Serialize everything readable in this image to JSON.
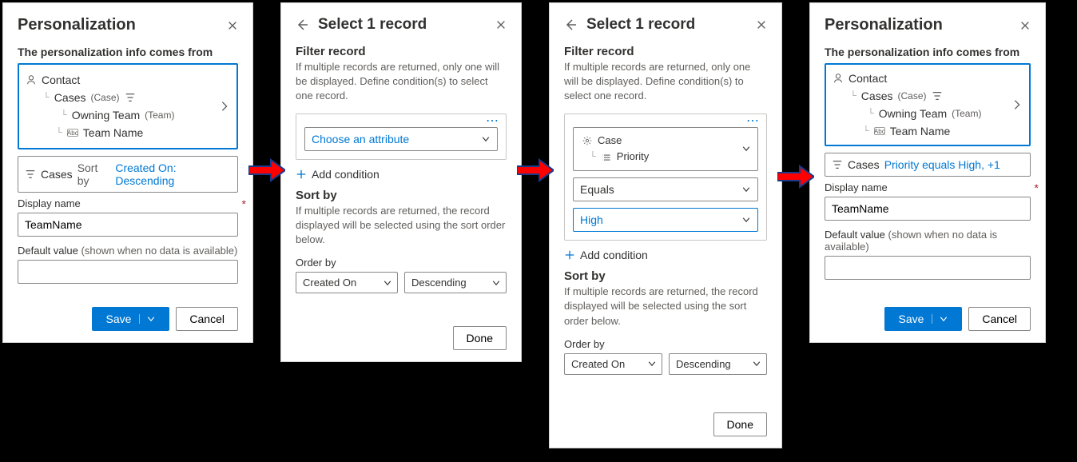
{
  "panel1": {
    "title": "Personalization",
    "info_label": "The personalization info comes from",
    "tree": {
      "root": "Contact",
      "node1": "Cases",
      "node1_type": "(Case)",
      "node2": "Owning Team",
      "node2_type": "(Team)",
      "leaf": "Team Name"
    },
    "filter_prefix": "Cases",
    "filter_sort_label": "Sort by",
    "filter_sort_value": "Created On: Descending",
    "display_name_label": "Display name",
    "display_name_value": "TeamName",
    "default_label": "Default value",
    "default_hint": "(shown when no data is available)",
    "save": "Save",
    "cancel": "Cancel"
  },
  "panel2": {
    "title": "Select 1 record",
    "section": "Filter record",
    "hint": "If multiple records are returned, only one will be displayed. Define condition(s) to select one record.",
    "placeholder": "Choose an attribute",
    "add_condition": "Add condition",
    "sortby": "Sort by",
    "sort_hint": "If multiple records are returned, the record displayed will be selected using the sort order below.",
    "orderby": "Order by",
    "order_field": "Created On",
    "order_dir": "Descending",
    "done": "Done"
  },
  "panel3": {
    "title": "Select 1 record",
    "section": "Filter record",
    "hint": "If multiple records are returned, only one will be displayed. Define condition(s) to select one record.",
    "entity": "Case",
    "attribute": "Priority",
    "operator": "Equals",
    "value": "High",
    "add_condition": "Add condition",
    "sortby": "Sort by",
    "sort_hint": "If multiple records are returned, the record displayed will be selected using the sort order below.",
    "orderby": "Order by",
    "order_field": "Created On",
    "order_dir": "Descending",
    "done": "Done"
  },
  "panel4": {
    "title": "Personalization",
    "info_label": "The personalization info comes from",
    "tree": {
      "root": "Contact",
      "node1": "Cases",
      "node1_type": "(Case)",
      "node2": "Owning Team",
      "node2_type": "(Team)",
      "leaf": "Team Name"
    },
    "filter_prefix": "Cases",
    "filter_detail": "Priority equals High, +1",
    "display_name_label": "Display name",
    "display_name_value": "TeamName",
    "default_label": "Default value",
    "default_hint": "(shown when no data is available)",
    "save": "Save",
    "cancel": "Cancel"
  }
}
